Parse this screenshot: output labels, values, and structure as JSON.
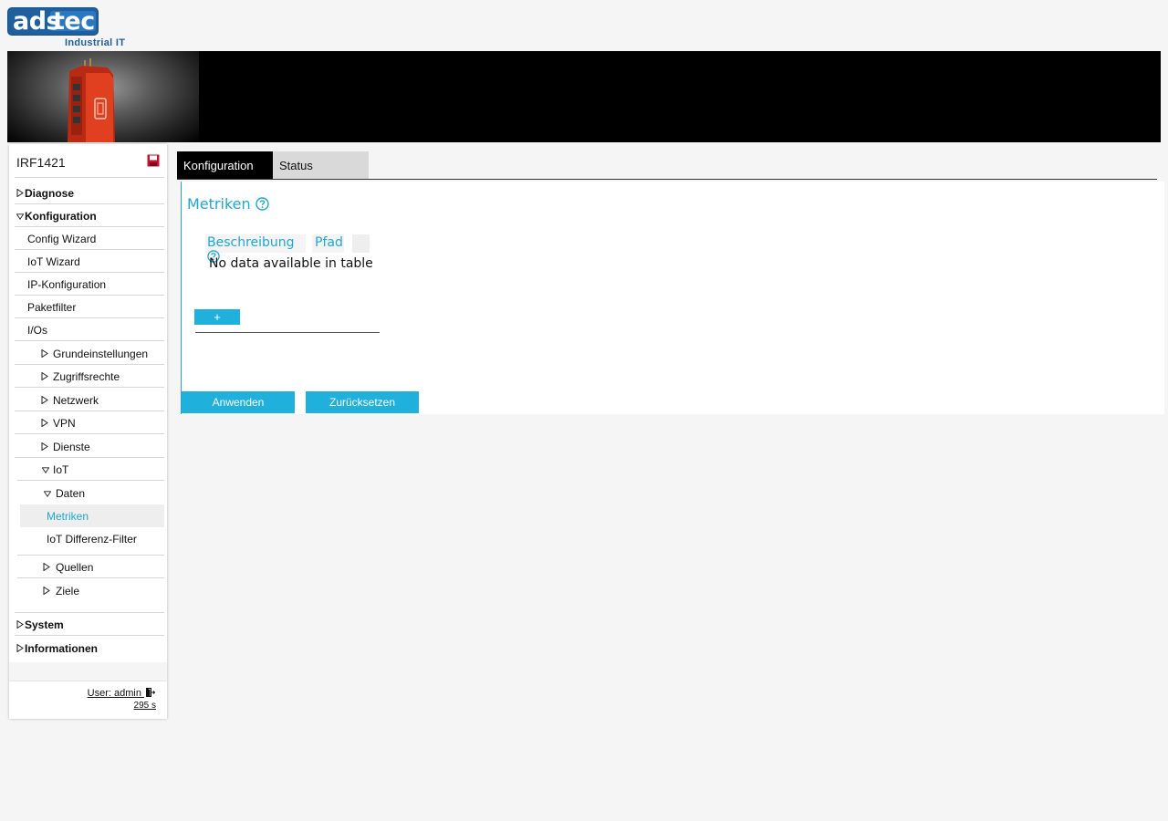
{
  "brand": {
    "logo_left": "ads",
    "logo_right": "tec",
    "tagline": "Industrial IT"
  },
  "colors": {
    "accent": "#1fa7d8",
    "button": "#1fb0dc",
    "active_tab_bg": "#000000",
    "brand_blue": "#1f5f9e",
    "device_red": "#d93a1f"
  },
  "sidebar": {
    "device": "IRF1421",
    "items": [
      {
        "label": "Diagnose",
        "bold": true,
        "expanded": false
      },
      {
        "label": "Konfiguration",
        "bold": true,
        "expanded": true
      },
      {
        "label": "Config Wizard"
      },
      {
        "label": "IoT Wizard"
      },
      {
        "label": "IP-Konfiguration"
      },
      {
        "label": "Paketfilter"
      },
      {
        "label": "I/Os"
      },
      {
        "label": "Grundeinstellungen",
        "expanded": false
      },
      {
        "label": "Zugriffsrechte",
        "expanded": false
      },
      {
        "label": "Netzwerk",
        "expanded": false
      },
      {
        "label": "VPN",
        "expanded": false
      },
      {
        "label": "Dienste",
        "expanded": false
      },
      {
        "label": "IoT",
        "expanded": true
      },
      {
        "label": "Daten",
        "expanded": true
      },
      {
        "label": "Metriken",
        "active": true
      },
      {
        "label": "IoT Differenz-Filter"
      },
      {
        "label": "Quellen",
        "expanded": false
      },
      {
        "label": "Ziele",
        "expanded": false
      },
      {
        "label": "System",
        "bold": true,
        "expanded": false
      },
      {
        "label": "Informationen",
        "bold": true,
        "expanded": false
      }
    ],
    "user": "User: admin",
    "timer": "295 s"
  },
  "tabs": [
    {
      "label": "Konfiguration",
      "active": true
    },
    {
      "label": "Status",
      "active": false
    }
  ],
  "main": {
    "title": "Metriken",
    "table": {
      "columns": [
        "Beschreibung",
        "Pfad",
        ""
      ],
      "empty_text": "No data available in table"
    },
    "add_label": "+",
    "apply_label": "Anwenden",
    "reset_label": "Zurücksetzen"
  }
}
